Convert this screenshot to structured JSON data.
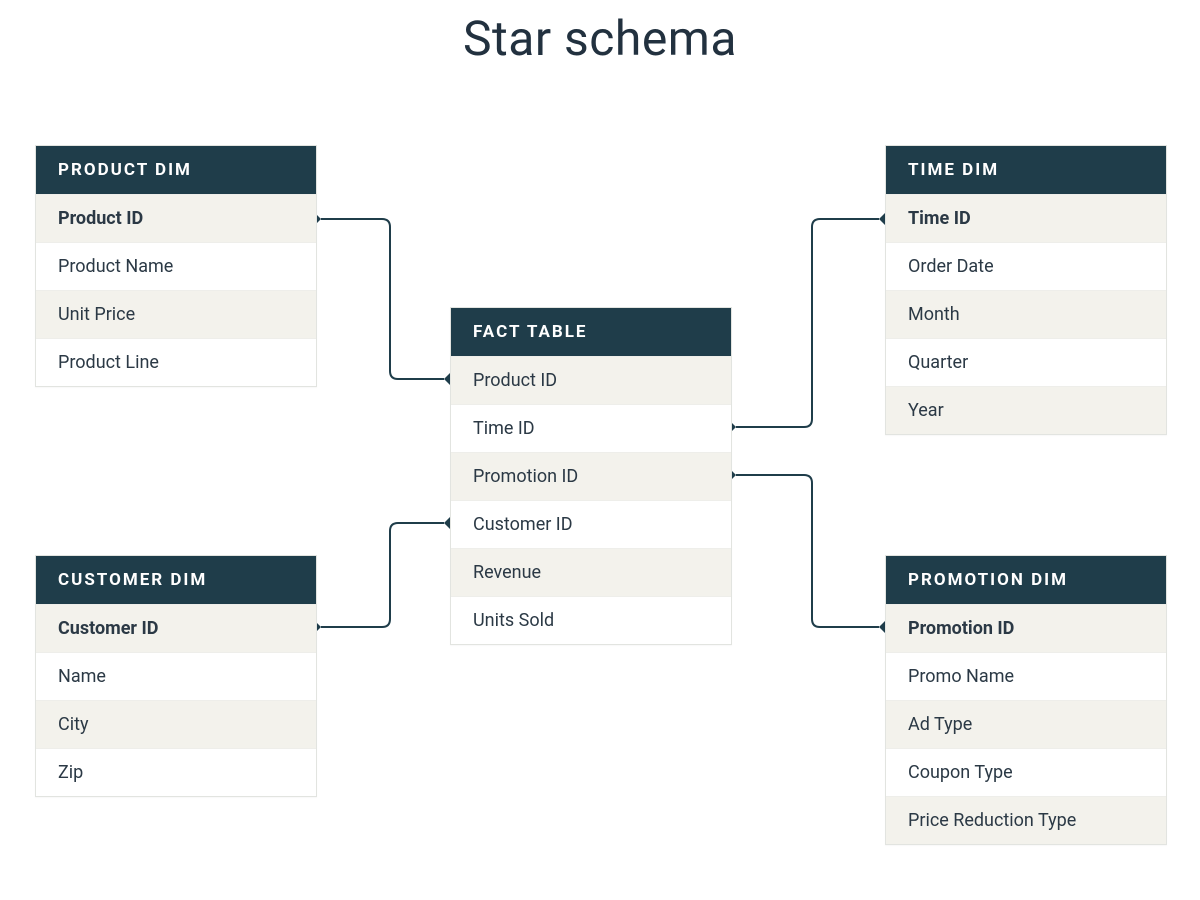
{
  "title": "Star schema",
  "tables": {
    "product": {
      "header": "PRODUCT DIM",
      "rows": [
        "Product ID",
        "Product Name",
        "Unit Price",
        "Product Line"
      ]
    },
    "time": {
      "header": "TIME DIM",
      "rows": [
        "Time ID",
        "Order Date",
        "Month",
        "Quarter",
        "Year"
      ]
    },
    "fact": {
      "header": "FACT TABLE",
      "rows": [
        "Product ID",
        "Time ID",
        "Promotion ID",
        "Customer ID",
        "Revenue",
        "Units Sold"
      ]
    },
    "customer": {
      "header": "CUSTOMER DIM",
      "rows": [
        "Customer ID",
        "Name",
        "City",
        "Zip"
      ]
    },
    "promotion": {
      "header": "PROMOTION DIM",
      "rows": [
        "Promotion ID",
        "Promo Name",
        "Ad Type",
        "Coupon Type",
        "Price Reduction Type"
      ]
    }
  }
}
